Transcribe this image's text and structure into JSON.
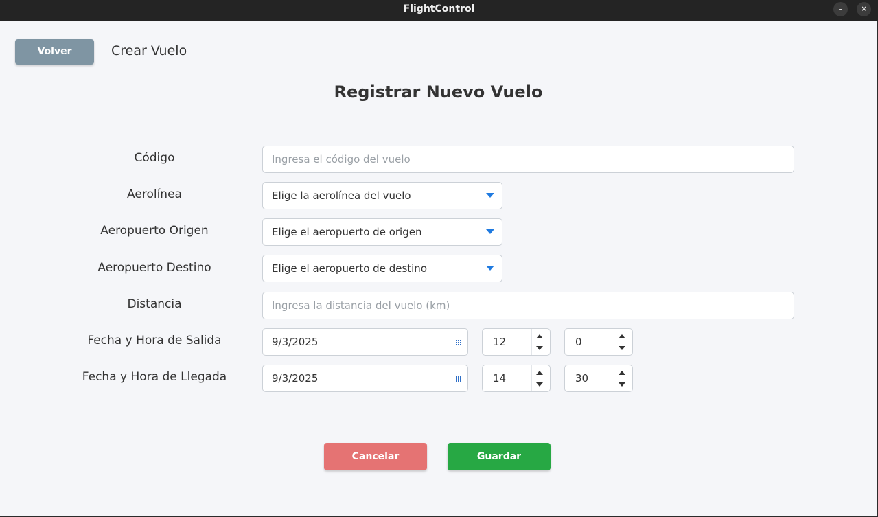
{
  "window": {
    "title": "FlightControl",
    "minimize_icon": "minimize-icon",
    "close_icon": "close-icon"
  },
  "header": {
    "back_label": "Volver",
    "page_title": "Crear Vuelo"
  },
  "form": {
    "title": "Registrar Nuevo Vuelo",
    "codigo": {
      "label": "Código",
      "placeholder": "Ingresa el código del vuelo"
    },
    "aerolinea": {
      "label": "Aerolínea",
      "selected": "Elige la aerolínea del vuelo"
    },
    "origen": {
      "label": "Aeropuerto Origen",
      "selected": "Elige el aeropuerto de origen"
    },
    "destino": {
      "label": "Aeropuerto Destino",
      "selected": "Elige el aeropuerto de destino"
    },
    "distancia": {
      "label": "Distancia",
      "placeholder": "Ingresa la distancia del vuelo (km)"
    },
    "salida": {
      "label": "Fecha y Hora de Salida",
      "date": "9/3/2025",
      "hour": "12",
      "minute": "0"
    },
    "llegada": {
      "label": "Fecha y Hora de Llegada",
      "date": "9/3/2025",
      "hour": "14",
      "minute": "30"
    }
  },
  "actions": {
    "cancel_label": "Cancelar",
    "save_label": "Guardar"
  },
  "colors": {
    "back_button": "#7f95a3",
    "cancel_button": "#e57373",
    "save_button": "#27a844",
    "accent": "#1f7ae0"
  }
}
